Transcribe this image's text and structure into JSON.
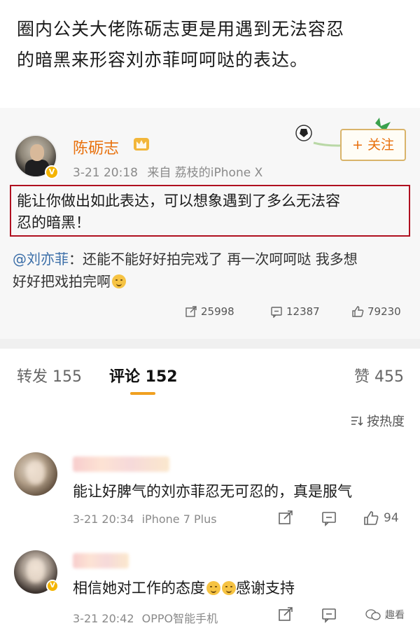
{
  "caption": {
    "line1": "圈内公关大佬陈砺志更是用遇到无法容忍",
    "line2": "的暗黑来形容刘亦菲呵呵哒的表达。"
  },
  "post": {
    "username": "陈砺志",
    "date": "3-21 20:18",
    "source_prefix": "来自",
    "source": "荔枝的iPhone X",
    "follow_label": "+ 关注",
    "text_line1": "能让你做出如此表达，可以想象遇到了多么无法容",
    "text_line2": "忍的暗黑！",
    "repost_at": "@刘亦菲",
    "repost_text_line1": "：还能不能好好拍完戏了 再一次呵呵哒 我多想",
    "repost_text_line2": "好好把戏拍完啊",
    "stats": {
      "reposts": "25998",
      "comments": "12387",
      "likes": "79230"
    }
  },
  "tabs": {
    "repost": "转发 155",
    "comments": "评论 152",
    "likes": "赞 455"
  },
  "sort_label": "按热度",
  "comments": [
    {
      "text": "能让好脾气的刘亦菲忍无可忍的，真是服气",
      "date": "3-21 20:34",
      "device": "iPhone 7 Plus",
      "likes": "94"
    },
    {
      "text": "相信她对工作的态度",
      "text_after": "感谢支持",
      "date": "3-21 20:42",
      "device": "OPPO智能手机"
    }
  ],
  "watermark": "趣看",
  "colors": {
    "username": "#e8700c",
    "link": "#3b6ea8",
    "highlight_border": "#b01020",
    "tab_underline": "#f0a020",
    "verified_badge": "#f4b400"
  }
}
